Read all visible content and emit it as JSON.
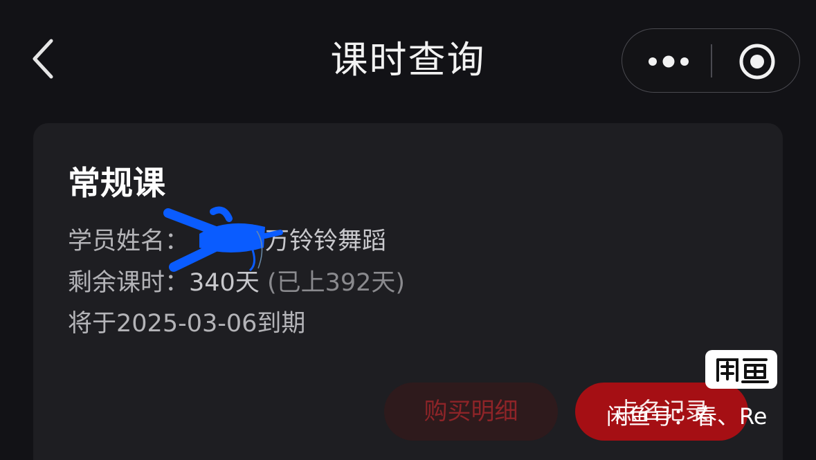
{
  "header": {
    "title": "课时查询"
  },
  "course": {
    "name": "常规课",
    "student_label": "学员姓名：",
    "student_value": "万铃铃舞蹈",
    "remaining_label": "剩余课时：",
    "remaining_value": "340天",
    "attended_text": "(已上392天)",
    "expiry_prefix": "将于",
    "expiry_date": "2025-03-06",
    "expiry_suffix": "到期"
  },
  "actions": {
    "purchase_label": "购买明细",
    "attendance_label": "点名记录"
  },
  "watermark": {
    "text": "闲鱼号：春、Re"
  },
  "colors": {
    "background": "#121216",
    "card": "#1e1e22",
    "accent_red": "#a50f14",
    "redaction_blue": "#0a5cff"
  },
  "icons": {
    "back": "chevron-left-icon",
    "more": "more-dots-icon",
    "close": "target-circle-icon",
    "watermark": "xianyu-logo"
  }
}
